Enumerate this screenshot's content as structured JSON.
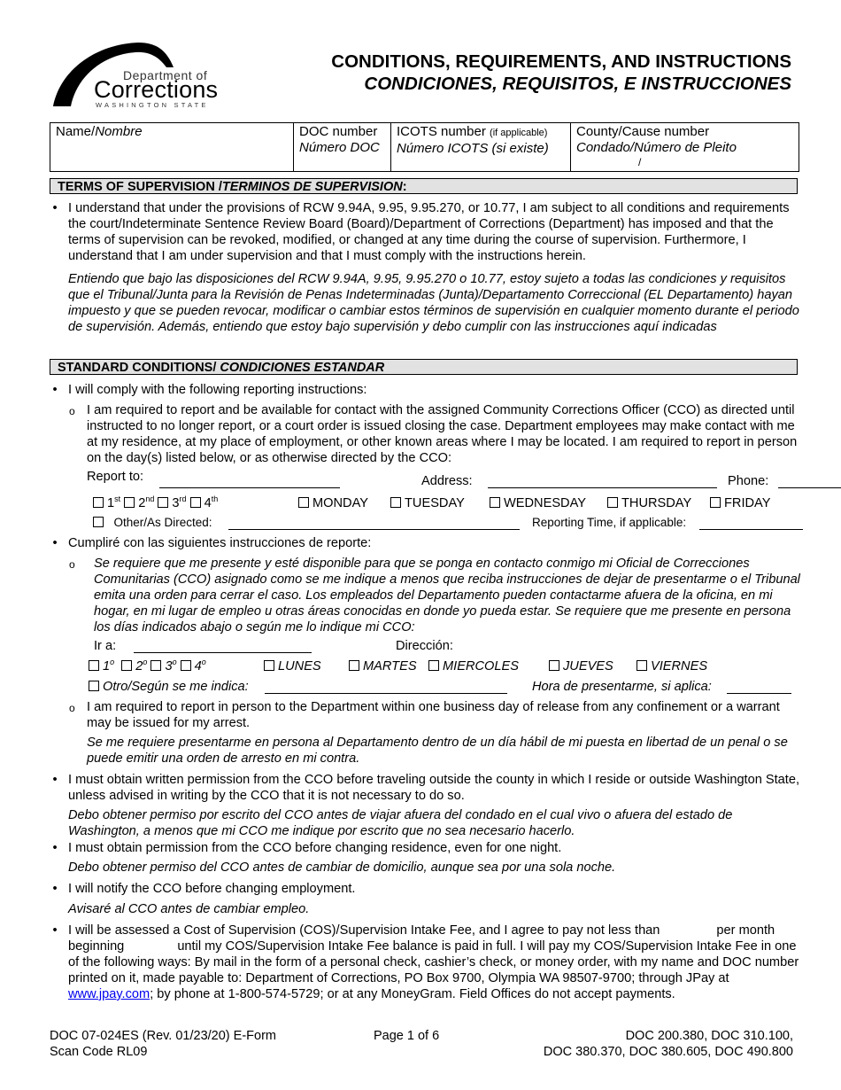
{
  "logo": {
    "line1": "Department of",
    "line2": "Corrections",
    "line3": "WASHINGTON STATE"
  },
  "title": {
    "en": "CONDITIONS, REQUIREMENTS, AND INSTRUCTIONS",
    "es": "CONDICIONES, REQUISITOS, E INSTRUCCIONES"
  },
  "info_table": {
    "name_en": "Name/",
    "name_es": "Nombre",
    "doc_en": "DOC number",
    "doc_es": "Número DOC",
    "icots_en": "ICOTS number",
    "icots_note": "(if applicable)",
    "icots_es": "Número ICOTS (si existe)",
    "county_en": "County/Cause number",
    "county_es": "Condado/Número de Pleito",
    "county_value": "/"
  },
  "terms": {
    "header_en": "TERMS OF SUPERVISION /",
    "header_es": "TERMINOS DE SUPERVISION",
    "header_colon": ":",
    "text_en": "I understand that under the provisions of RCW 9.94A, 9.95, 9.95.270, or 10.77, I am subject to all conditions and requirements the court/Indeterminate Sentence Review Board (Board)/Department of Corrections (Department) has imposed and that the terms of supervision can be revoked, modified, or changed at any time during the course of supervision.  Furthermore, I understand that I am under supervision and that I must comply with the instructions herein.",
    "text_es": "Entiendo que bajo las disposiciones del RCW 9.94A, 9.95, 9.95.270 o 10.77, estoy sujeto a todas las condiciones y requisitos que el Tribunal/Junta para la Revisión de Penas Indeterminadas (Junta)/Departamento Correccional (EL Departamento) hayan impuesto y que se pueden revocar, modificar o cambiar estos términos de supervisión en cualquier momento durante el periodo de supervisión.  Además, entiendo que estoy bajo supervisión y debo cumplir con las instrucciones aquí indicadas"
  },
  "standard": {
    "header_en": "STANDARD CONDITIONS/ ",
    "header_es": "CONDICIONES ESTANDAR",
    "reporting_en": "I will comply with the following reporting instructions:",
    "reporting_sub_en": "I am required to report and be available for contact with the assigned Community Corrections Officer (CCO) as directed until instructed to no longer report, or a court order is issued closing the case.  Department employees may make contact with me at my residence, at my place of employment, or other known areas where I may be located.  I am required to report in person on the day(s) listed below, or as otherwise directed by the CCO:",
    "form_en": {
      "report_to": "Report to:",
      "address": "Address:",
      "phone": "Phone:",
      "weeks": [
        {
          "num": "1",
          "sup": "st"
        },
        {
          "num": "2",
          "sup": "nd"
        },
        {
          "num": "3",
          "sup": "rd"
        },
        {
          "num": "4",
          "sup": "th"
        }
      ],
      "days": [
        "MONDAY",
        "TUESDAY",
        "WEDNESDAY",
        "THURSDAY",
        "FRIDAY"
      ],
      "other": "Other/As Directed:",
      "time": "Reporting Time, if applicable:"
    },
    "reporting_es": "Cumpliré con las siguientes instrucciones de reporte:",
    "reporting_sub_es": "Se requiere que me presente y esté disponible para que se ponga en contacto conmigo mi Oficial de Correcciones Comunitarias (CCO) asignado como se me indique a menos que reciba instrucciones de dejar de presentarme o el Tribunal emita una orden para cerrar el caso. Los empleados del Departamento pueden contactarme afuera de la oficina, en mi hogar, en mi lugar de empleo u otras áreas conocidas en donde yo pueda estar. Se requiere que me presente en persona los días indicados abajo o según me lo indique mi CCO:",
    "form_es": {
      "report_to": "Ir a:",
      "address": "Dirección:",
      "weeks": [
        {
          "num": "1",
          "sup": "o"
        },
        {
          "num": "2",
          "sup": "o"
        },
        {
          "num": "3",
          "sup": "o"
        },
        {
          "num": "4",
          "sup": "o"
        }
      ],
      "days": [
        "LUNES",
        "MARTES",
        "MIERCOLES",
        "JUEVES",
        "VIERNES"
      ],
      "other": "Otro/Según se me indica:",
      "time": "Hora de presentarme, si aplica:"
    },
    "release_en": "I am required to report in person to the Department within one business day of release from any confinement or a warrant may be issued for my arrest.",
    "release_es": "Se me requiere presentarme en persona al Departamento dentro de un día hábil de mi puesta en libertad de un penal o se puede emitir una orden de arresto en mi contra.",
    "travel_en": "I must obtain written permission from the CCO before traveling outside the county in which I reside or outside Washington State, unless advised in writing by the CCO that it is not necessary to do so.",
    "travel_es": "Debo obtener permiso por escrito del CCO antes de viajar afuera del condado en el cual vivo o afuera del estado de Washington, a menos que mi CCO me indique por escrito que no sea necesario hacerlo.",
    "residence_en": "I must obtain permission from the CCO before changing residence, even for one night.",
    "residence_es": "Debo obtener permiso del CCO antes de cambiar de domicilio, aunque sea por una sola noche.",
    "employment_en": "I will notify the CCO before changing employment.",
    "employment_es": "Avisaré al CCO antes de cambiar empleo.",
    "fee": {
      "part1": "I will be assessed a Cost of Supervision (COS)/Supervision Intake Fee, and I agree to pay not less than",
      "part2": "per",
      "part3": "month beginning",
      "part4": "until my COS/Supervision Intake Fee balance is paid in full.  I will pay my COS/Supervision Intake Fee in one of the following ways:  By mail in the form of a personal check, cashier’s check, or money order, with my name and DOC number printed on it, made payable to:  Department of Corrections, PO Box 9700, Olympia WA 98507-9700; through JPay at ",
      "link": "www.jpay.com",
      "part5": "; by phone at 1-800-574-5729; or at any MoneyGram.  Field Offices do not accept payments."
    }
  },
  "footer": {
    "form_id": "DOC 07-024ES (Rev. 01/23/20) E-Form",
    "scan_code": "Scan Code RL09",
    "page": "Page 1 of 6",
    "refs1": "DOC 200.380, DOC 310.100,",
    "refs2": "DOC 380.370, DOC 380.605, DOC 490.800"
  },
  "colors": {
    "section_header_bg": "#e2e2e2",
    "link": "#0000ee"
  }
}
